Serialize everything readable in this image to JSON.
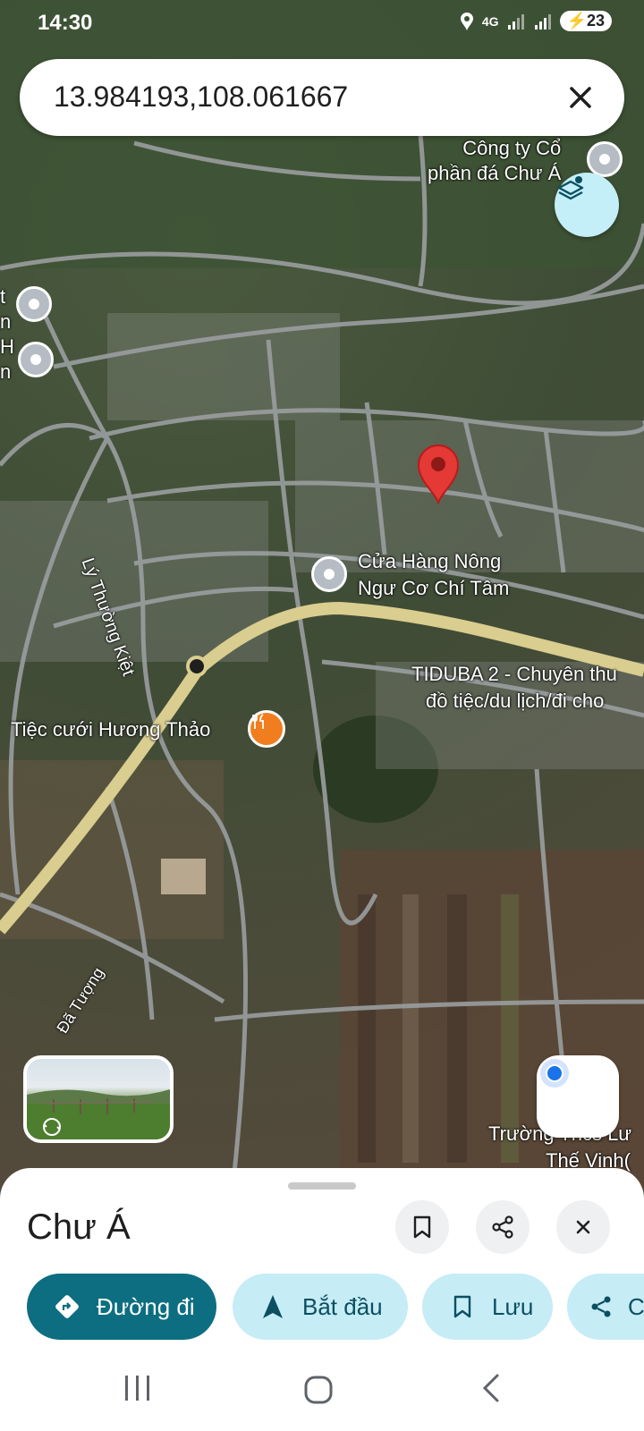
{
  "status_bar": {
    "time": "14:30",
    "network": "4G",
    "battery": "23"
  },
  "search": {
    "query": "13.984193,108.061667"
  },
  "map_labels": {
    "poi_top_right": "Công ty Cổ\nphần đá Chư Á",
    "poi_store_line1": "Cửa Hàng Nông",
    "poi_store_line2": "Ngư Cơ Chí Tâm",
    "poi_tiduba_line1": "TIDUBA 2 - Chuyên thu",
    "poi_tiduba_line2": "đồ tiệc/du lịch/đi cho",
    "poi_restaurant": "Tiệc cưới Hương Thảo",
    "street_ly_thuong_kiet": "Lý Thường Kiệt",
    "street_da_tuong": "Đã Tượng",
    "poi_school_line1": "Trường Thcs Lư",
    "poi_school_line2": "Thế Vinh(",
    "left_edge_1": "t",
    "left_edge_2": "n",
    "left_edge_3": "H",
    "left_edge_4": "n"
  },
  "place": {
    "name": "Chư Á"
  },
  "actions": {
    "directions": "Đường đi",
    "start": "Bắt đầu",
    "save": "Lưu",
    "share_partial": "C"
  },
  "colors": {
    "primary": "#0c6e80",
    "chip_light": "#c6ecf6",
    "pin_red": "#e53935",
    "road_yellow": "#d9cd8f"
  },
  "icons": {
    "clear": "close-icon",
    "layers": "layers-icon",
    "my_location": "my-location-icon",
    "bookmark": "bookmark-icon",
    "share": "share-icon",
    "close": "close-icon",
    "directions": "directions-icon",
    "navigate": "navigation-arrow-icon"
  }
}
